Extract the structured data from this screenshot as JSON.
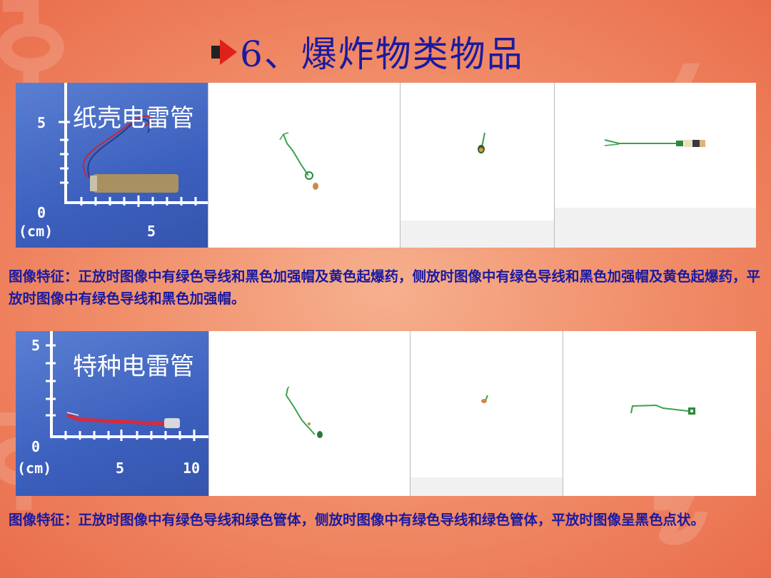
{
  "slide": {
    "title": "6、爆炸物类物品",
    "background_color": "#f08a66"
  },
  "rows": [
    {
      "photo_label": "纸壳电雷管",
      "ruler": {
        "y_tick": "5",
        "origin": "0",
        "unit": "(cm)",
        "x_tick": "5"
      },
      "views": [
        "xray-view-upright",
        "xray-view-side",
        "xray-view-flat"
      ],
      "caption": "图像特征：正放时图像中有绿色导线和黑色加强帽及黄色起爆药，侧放时图像中有绿色导线和黑色加强帽及黄色起爆药，平放时图像中有绿色导线和黑色加强帽。"
    },
    {
      "photo_label": "特种电雷管",
      "ruler": {
        "y_tick": "5",
        "origin": "0",
        "unit": "(cm)",
        "x_tick": "5",
        "x_tick2": "10"
      },
      "views": [
        "xray-view-upright",
        "xray-view-side",
        "xray-view-flat"
      ],
      "caption": "图像特征：正放时图像中有绿色导线和绿色管体，侧放时图像中有绿色导线和绿色管体，平放时图像呈黑色点状。"
    }
  ],
  "colors": {
    "title": "#1a1aa0",
    "caption": "#1a1aa0",
    "photo_bg": "#3c60be",
    "wire_green": "#2e9a3e"
  }
}
